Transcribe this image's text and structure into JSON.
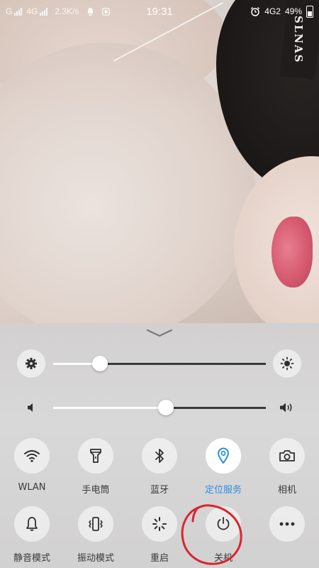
{
  "status_bar": {
    "carrier1": "G",
    "carrier2": "4G",
    "speed": "2.3K/s",
    "time": "19:31",
    "network_right": "4G2",
    "battery": "49%",
    "icons": [
      "signal-bars-icon",
      "notification-icon",
      "image-icon",
      "alarm-icon",
      "battery-icon"
    ]
  },
  "wallpaper": {
    "tag_text": "SLNAS"
  },
  "control_center": {
    "brightness": {
      "level": 0.22,
      "icon_low": "gear-icon",
      "icon_high": "sun-icon"
    },
    "volume": {
      "level": 0.53,
      "icon_low": "speaker-low-icon",
      "icon_high": "speaker-high-icon"
    },
    "row1": [
      {
        "label": "WLAN",
        "icon": "wifi-icon",
        "active": false
      },
      {
        "label": "手电筒",
        "icon": "flashlight-icon",
        "active": false
      },
      {
        "label": "蓝牙",
        "icon": "bluetooth-icon",
        "active": false
      },
      {
        "label": "定位服务",
        "icon": "location-icon",
        "active": true
      },
      {
        "label": "相机",
        "icon": "camera-icon",
        "active": false
      }
    ],
    "row2": [
      {
        "label": "静音模式",
        "icon": "bell-icon"
      },
      {
        "label": "振动模式",
        "icon": "vibrate-icon"
      },
      {
        "label": "重启",
        "icon": "restart-icon"
      },
      {
        "label": "关机",
        "icon": "power-icon"
      },
      {
        "label": "",
        "icon": "more-icon"
      }
    ]
  },
  "colors": {
    "accent": "#2c8fe0",
    "annotation": "#d8262f"
  }
}
